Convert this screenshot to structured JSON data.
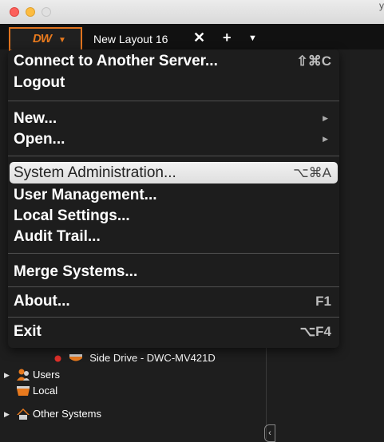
{
  "window": {
    "title_fragment": "y"
  },
  "tabbar": {
    "logo": "DW",
    "tab_label": "New Layout 16",
    "close_glyph": "✕",
    "add_glyph": "+",
    "menu_glyph": "▼"
  },
  "menu": {
    "items": [
      {
        "label": "Connect to Another Server...",
        "shortcut": "⇧⌘C"
      },
      {
        "label": "Logout",
        "shortcut": ""
      },
      {
        "label": "New...",
        "shortcut": "",
        "submenu": true
      },
      {
        "label": "Open...",
        "shortcut": "",
        "submenu": true
      },
      {
        "label": "System Administration...",
        "shortcut": "⌥⌘A",
        "highlighted": true
      },
      {
        "label": "User Management...",
        "shortcut": ""
      },
      {
        "label": "Local Settings...",
        "shortcut": ""
      },
      {
        "label": "Audit Trail...",
        "shortcut": ""
      },
      {
        "label": "Merge Systems...",
        "shortcut": ""
      },
      {
        "label": "About...",
        "shortcut": "F1"
      },
      {
        "label": "Exit",
        "shortcut": "⌥F4"
      }
    ]
  },
  "tree": {
    "camera_label": "Side Drive - DWC-MV421D",
    "users_label": "Users",
    "local_label": "Local",
    "other_systems_label": "Other Systems"
  },
  "colors": {
    "accent": "#e87a1e",
    "status_red": "#e0302a"
  }
}
